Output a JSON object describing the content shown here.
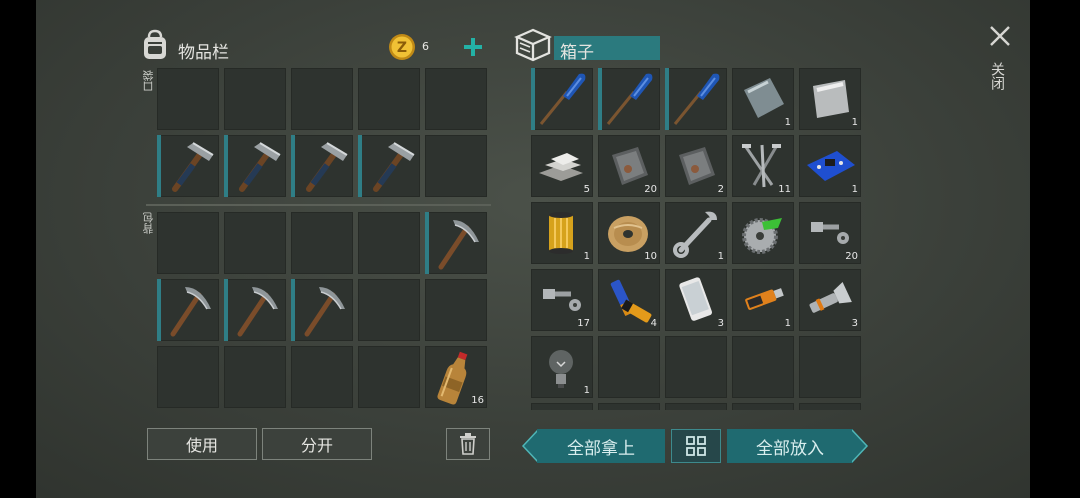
{
  "inventory": {
    "title": "物品栏",
    "coin_count": "6",
    "section_pocket": "口袋",
    "section_backpack": "背包",
    "slot_counts": {
      "bottle": "16"
    }
  },
  "box": {
    "title": "箱子",
    "counts": [
      "",
      "",
      "",
      "1",
      "1",
      "5",
      "20",
      "2",
      "11",
      "1",
      "1",
      "10",
      "1",
      "",
      "20",
      "17",
      "4",
      "3",
      "1",
      "3",
      "1"
    ]
  },
  "actions": {
    "use": "使用",
    "split": "分开",
    "take_all": "全部拿上",
    "put_all": "全部放入"
  },
  "close": {
    "label": "关闭"
  },
  "colors": {
    "accent": "#2f7e86",
    "button_teal": "#1f6a70"
  }
}
